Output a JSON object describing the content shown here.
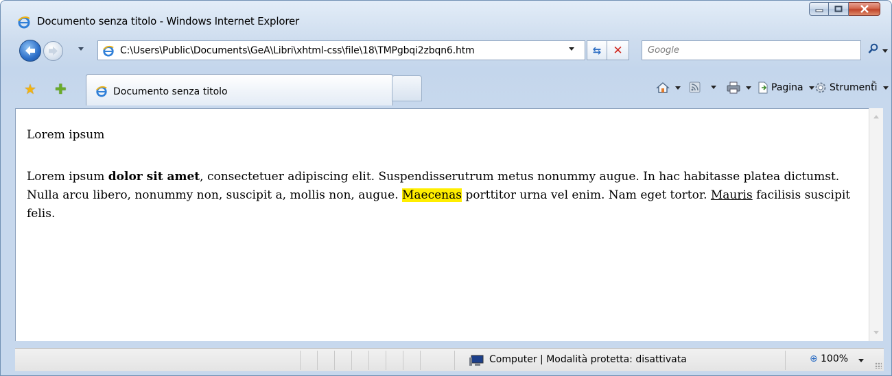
{
  "window": {
    "title": "Documento senza titolo  - Windows Internet Explorer"
  },
  "address_bar": {
    "url": "C:\\Users\\Public\\Documents\\GeA\\Libri\\xhtml-css\\file\\18\\TMPgbqi2zbqn6.htm"
  },
  "search": {
    "placeholder": "Google"
  },
  "tab": {
    "label": "Documento senza titolo"
  },
  "command_bar": {
    "page_label": "Pagina",
    "tools_label": "Strumenti"
  },
  "content": {
    "heading": "Lorem ipsum",
    "paragraph": {
      "t1": "Lorem ipsum ",
      "bold": "dolor sit amet",
      "t2": ", consectetuer adipiscing elit. Suspendisserutrum metus nonummy augue. In hac habitasse platea dictumst. Nulla arcu libero, nonummy non, suscipit a, mollis non, augue. ",
      "highlight": "Maecenas",
      "t3": " porttitor urna vel enim. Nam eget tortor. ",
      "underline": "Mauris",
      "t4": " facilisis suscipit felis."
    }
  },
  "status_bar": {
    "zone_text": "Computer | Modalità protetta: disattivata",
    "zoom_text": "100%"
  },
  "colors": {
    "highlight": "#ffee00",
    "chrome": "#cddcee"
  },
  "icons": [
    "ie-logo-icon",
    "back-icon",
    "forward-icon",
    "refresh-icon",
    "stop-icon",
    "search-icon",
    "favorites-star-icon",
    "add-favorites-icon",
    "home-icon",
    "feeds-icon",
    "print-icon",
    "page-icon",
    "tools-gear-icon",
    "computer-zone-icon",
    "zoom-icon"
  ]
}
